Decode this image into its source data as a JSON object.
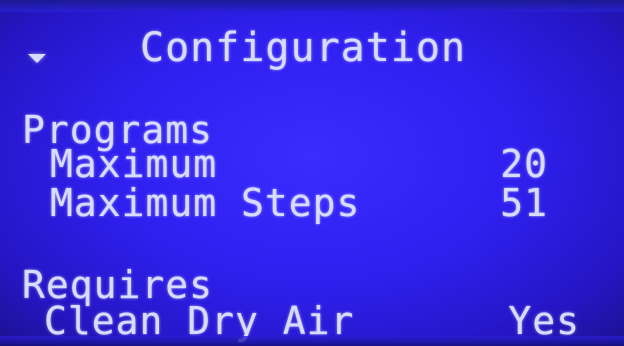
{
  "screen": {
    "title": "Configuration",
    "menu_icon": "down-arrow-icon",
    "background_color": "#2f20f0",
    "text_color": "#d7dcff"
  },
  "programs": {
    "heading": "Programs",
    "rows": [
      {
        "label": "Maximum",
        "value": "20"
      },
      {
        "label": "Maximum Steps",
        "value": "51"
      }
    ]
  },
  "requires": {
    "heading": "Requires",
    "rows": [
      {
        "label": "Clean Dry Air",
        "value": "Yes"
      }
    ]
  }
}
